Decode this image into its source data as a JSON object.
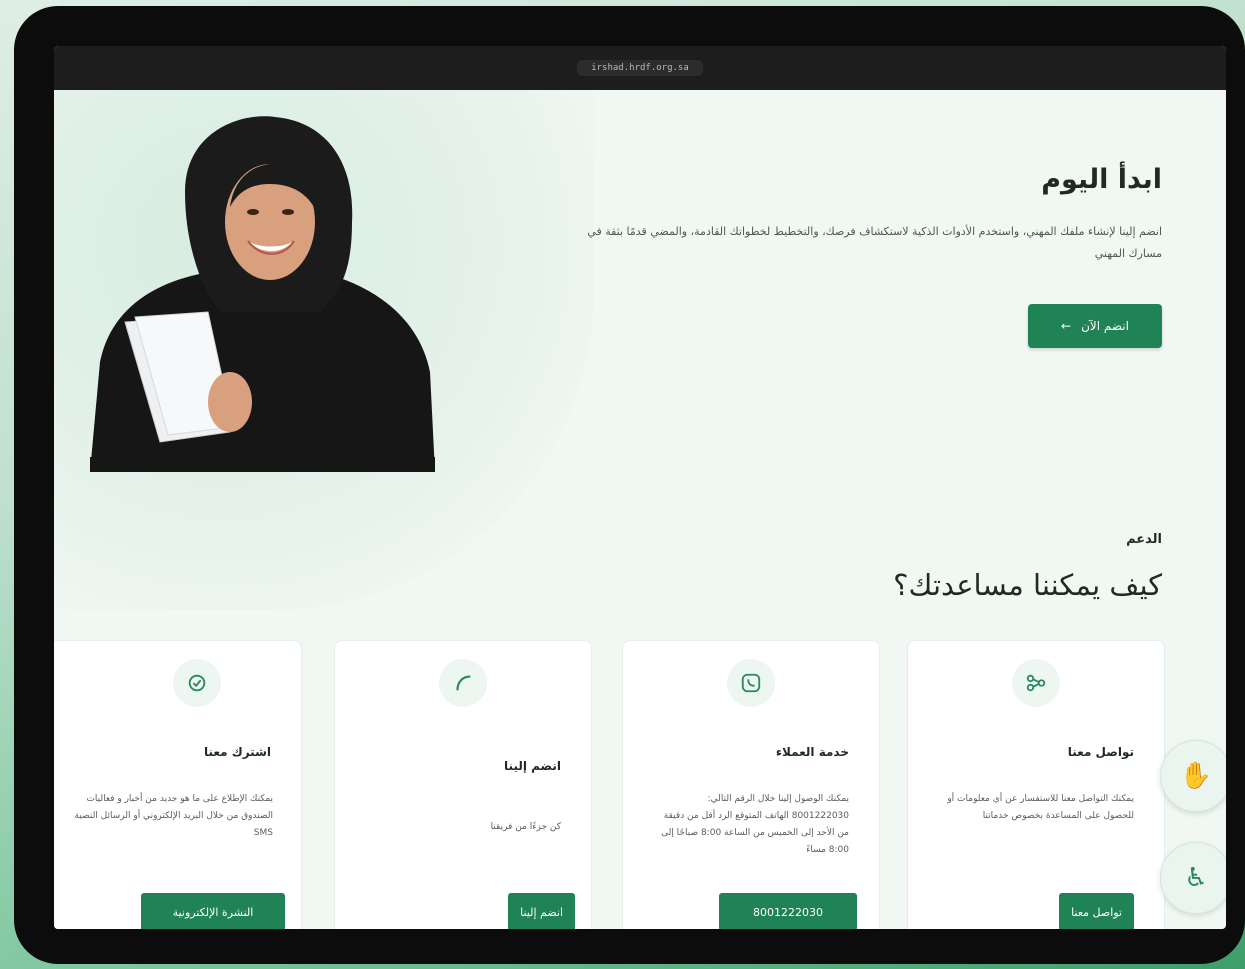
{
  "browser": {
    "url": "irshad.hrdf.org.sa"
  },
  "hero": {
    "title": "ابدأ اليوم",
    "description": "انضم إلينا لإنشاء ملفك المهني، واستخدم الأدوات الذكية لاستكشاف فرصك، والتخطيط لخطواتك القادمة، والمضي قدمًا بثقة في مسارك المهني",
    "cta_label": "انضم الآن",
    "cta_icon": "arrow-left-icon"
  },
  "support": {
    "label": "الدعم",
    "title": "كيف يمكننا مساعدتك؟",
    "cards": [
      {
        "icon": "share-icon",
        "title": "تواصل معنا",
        "description": "يمكنك التواصل معنا للاستفسار عن أي معلومات أو للحصول على المساعدة بخصوص خدماتنا",
        "button": "تواصل معنا"
      },
      {
        "icon": "whatsapp-icon",
        "title": "خدمة العملاء",
        "description": "يمكنك الوصول إلينا خلال الرقم التالي: 8001222030 الهاتف المتوقع الرد أقل من دقيقة من الأحد إلى الخميس من الساعة 8:00 صباحًا إلى 8:00 مساءً",
        "button": "8001222030"
      },
      {
        "icon": "phone-icon",
        "title": "انضم إلينا",
        "description": "كن جزءًا من فريقنا",
        "button": "انضم إلينا"
      },
      {
        "icon": "newsletter-icon",
        "title": "اشترك معنا",
        "description": "يمكنك الإطلاع على ما هو جديد من أخبار و فعاليات الصندوق من خلال البريد الإلكتروني أو الرسائل النصية SMS",
        "button": "النشرة الإلكترونية"
      }
    ]
  },
  "floating_buttons": [
    {
      "icon": "hand-icon"
    },
    {
      "icon": "accessibility-icon"
    }
  ],
  "colors": {
    "primary": "#1f8355",
    "background": "#f1f7f3",
    "frame": "#0c0c0c"
  }
}
